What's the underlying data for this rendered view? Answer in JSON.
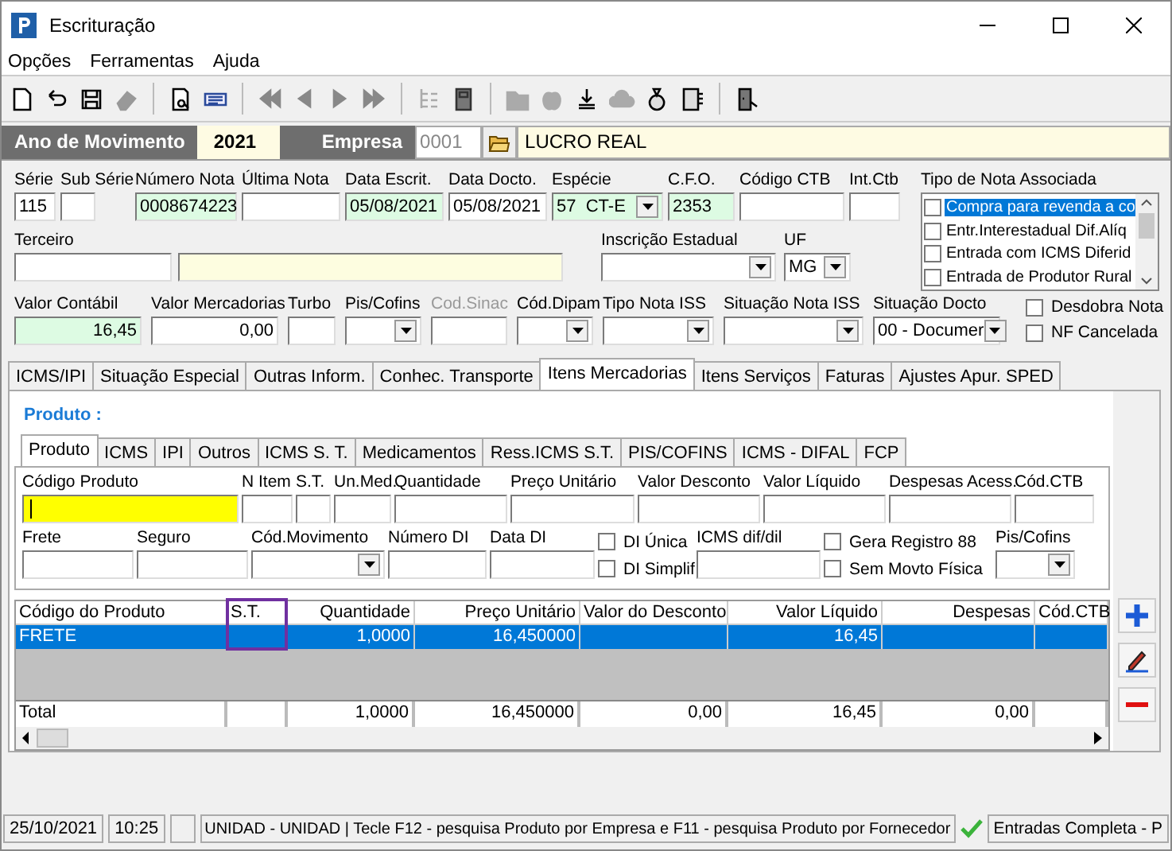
{
  "window": {
    "title": "Escrituração"
  },
  "menu": [
    "Opções",
    "Ferramentas",
    "Ajuda"
  ],
  "header": {
    "year_label": "Ano de Movimento",
    "year": "2021",
    "company_label": "Empresa",
    "company_code": "0001",
    "company_name": "LUCRO REAL"
  },
  "row1": [
    {
      "kind": "text",
      "label": "Série",
      "value": "115",
      "highlighted": false
    },
    {
      "kind": "text",
      "label": "Sub Série",
      "highlighted": false
    },
    {
      "kind": "text",
      "label": "Número Nota",
      "value": "0008674223",
      "highlighted": true
    },
    {
      "kind": "text",
      "label": "Última Nota",
      "highlighted": false
    },
    {
      "kind": "text",
      "label": "Data Escrit.",
      "value": "05/08/2021",
      "highlighted": true
    },
    {
      "kind": "text",
      "label": "Data Docto.",
      "value": "05/08/2021",
      "highlighted": false
    },
    {
      "kind": "combo",
      "label": "Espécie",
      "value": "57  CT-E",
      "highlighted": true
    },
    {
      "kind": "text",
      "label": "C.F.O.",
      "value": "2353",
      "highlighted": true
    },
    {
      "kind": "text",
      "label": "Código CTB",
      "highlighted": false
    },
    {
      "kind": "text",
      "label": "Int.Ctb",
      "highlighted": false
    }
  ],
  "third_party": {
    "label": "Terceiro"
  },
  "row2": [
    {
      "kind": "combo",
      "label": "Inscrição Estadual",
      "highlighted": false
    },
    {
      "kind": "combo",
      "label": "UF",
      "value": "MG",
      "highlighted": false
    }
  ],
  "note_types": {
    "label": "Tipo de Nota Associada",
    "items": [
      {
        "label": "Compra para revenda a co",
        "checked": false,
        "selected": true
      },
      {
        "label": "Entr.Interestadual Dif.Alíq",
        "checked": false,
        "selected": false
      },
      {
        "label": "Entrada com ICMS Diferid",
        "checked": false,
        "selected": false
      },
      {
        "label": "Entrada de Produtor Rural",
        "checked": false,
        "selected": false
      }
    ]
  },
  "row3": [
    {
      "kind": "text",
      "label": "Valor Contábil",
      "value": "16,45",
      "highlighted": true
    },
    {
      "kind": "text",
      "label": "Valor Mercadorias",
      "value": "0,00",
      "highlighted": false
    },
    {
      "kind": "text",
      "label": "Turbo",
      "highlighted": false
    },
    {
      "kind": "combo",
      "label": "Pis/Cofins",
      "highlighted": false
    },
    {
      "kind": "text",
      "label": "Cod.Sinac",
      "highlighted": false,
      "disabled": true
    },
    {
      "kind": "combo",
      "label": "Cód.Dipam",
      "highlighted": false
    },
    {
      "kind": "combo",
      "label": "Tipo Nota ISS",
      "highlighted": false
    },
    {
      "kind": "combo",
      "label": "Situação Nota ISS",
      "highlighted": false
    },
    {
      "kind": "combo",
      "label": "Situação Docto",
      "value": "00 - Documer",
      "highlighted": false
    },
    {
      "kind": "checks",
      "items": [
        {
          "label": "Desdobra Nota",
          "checked": false
        },
        {
          "label": "NF Cancelada",
          "checked": false
        }
      ]
    }
  ],
  "tabs": [
    {
      "label": "ICMS/IPI",
      "selected": false
    },
    {
      "label": "Situação Especial",
      "selected": false
    },
    {
      "label": "Outras Inform.",
      "selected": false
    },
    {
      "label": "Conhec. Transporte",
      "selected": false
    },
    {
      "label": "Itens Mercadorias",
      "selected": true
    },
    {
      "label": "Itens Serviços",
      "selected": false
    },
    {
      "label": "Faturas",
      "selected": false
    },
    {
      "label": "Ajustes Apur. SPED",
      "selected": false
    }
  ],
  "section_title": "Produto :",
  "subtabs": [
    {
      "label": "Produto",
      "selected": true
    },
    {
      "label": "ICMS",
      "selected": false
    },
    {
      "label": "IPI",
      "selected": false
    },
    {
      "label": "Outros",
      "selected": false
    },
    {
      "label": "ICMS S. T.",
      "selected": false
    },
    {
      "label": "Medicamentos",
      "selected": false
    },
    {
      "label": "Ress.ICMS S.T.",
      "selected": false
    },
    {
      "label": "PIS/COFINS",
      "selected": false
    },
    {
      "label": "ICMS - DIFAL",
      "selected": false
    },
    {
      "label": "FCP",
      "selected": false
    }
  ],
  "product_row1": [
    {
      "kind": "text",
      "label": "Código Produto",
      "highlighted": true,
      "focused": true
    },
    {
      "kind": "text",
      "label": "N Item",
      "highlighted": false
    },
    {
      "kind": "text",
      "label": "S.T.",
      "highlighted": false
    },
    {
      "kind": "text",
      "label": "Un.Med.",
      "highlighted": false
    },
    {
      "kind": "text",
      "label": "Quantidade",
      "highlighted": false
    },
    {
      "kind": "text",
      "label": "Preço Unitário",
      "highlighted": false
    },
    {
      "kind": "text",
      "label": "Valor Desconto",
      "highlighted": false
    },
    {
      "kind": "text",
      "label": "Valor Líquido",
      "highlighted": false
    },
    {
      "kind": "text",
      "label": "Despesas Acess.",
      "highlighted": false
    },
    {
      "kind": "text",
      "label": "Cód.CTB",
      "highlighted": false
    }
  ],
  "product_row2": [
    {
      "kind": "text",
      "label": "Frete",
      "highlighted": false
    },
    {
      "kind": "text",
      "label": "Seguro",
      "highlighted": false
    },
    {
      "kind": "combo",
      "label": "Cód.Movimento",
      "highlighted": false
    },
    {
      "kind": "text",
      "label": "Número DI",
      "highlighted": false
    },
    {
      "kind": "text",
      "label": "Data DI",
      "highlighted": false
    },
    {
      "kind": "checks",
      "items": [
        {
          "label": "DI Única",
          "checked": false
        },
        {
          "label": "DI Simplif",
          "checked": false
        }
      ]
    },
    {
      "kind": "text",
      "label": "ICMS dif/dil",
      "highlighted": false
    },
    {
      "kind": "checks",
      "items": [
        {
          "label": "Gera Registro 88",
          "checked": false
        },
        {
          "label": "Sem Movto Física",
          "checked": false
        }
      ]
    },
    {
      "kind": "combo",
      "label": "Pis/Cofins",
      "highlighted": false
    }
  ],
  "grid": {
    "columns": [
      {
        "label": "Código do Produto",
        "outlined": false
      },
      {
        "label": "S.T.",
        "outlined": true
      },
      {
        "label": "Quantidade",
        "outlined": false
      },
      {
        "label": "Preço Unitário",
        "outlined": false
      },
      {
        "label": "Valor do Desconto",
        "outlined": false
      },
      {
        "label": "Valor Líquido",
        "outlined": false
      },
      {
        "label": "Despesas",
        "outlined": false
      },
      {
        "label": "Cód.CTB",
        "outlined": false
      }
    ],
    "rows": [
      {
        "selected": true,
        "cells": {
          "product": "FRETE",
          "quantity": "1,0000",
          "unit_price": "16,450000",
          "net_value": "16,45"
        }
      }
    ],
    "total": {
      "product": "Total",
      "quantity": "1,0000",
      "unit_price": "16,450000",
      "discount": "0,00",
      "net_value": "16,45",
      "expenses": "0,00"
    }
  },
  "status_bar": {
    "date": "25/10/2021",
    "time": "10:25",
    "message": "UNIDAD - UNIDAD | Tecle F12 - pesquisa Produto por Empresa e F11 - pesquisa Produto por Fornecedor",
    "module": "Entradas Completa - P"
  }
}
